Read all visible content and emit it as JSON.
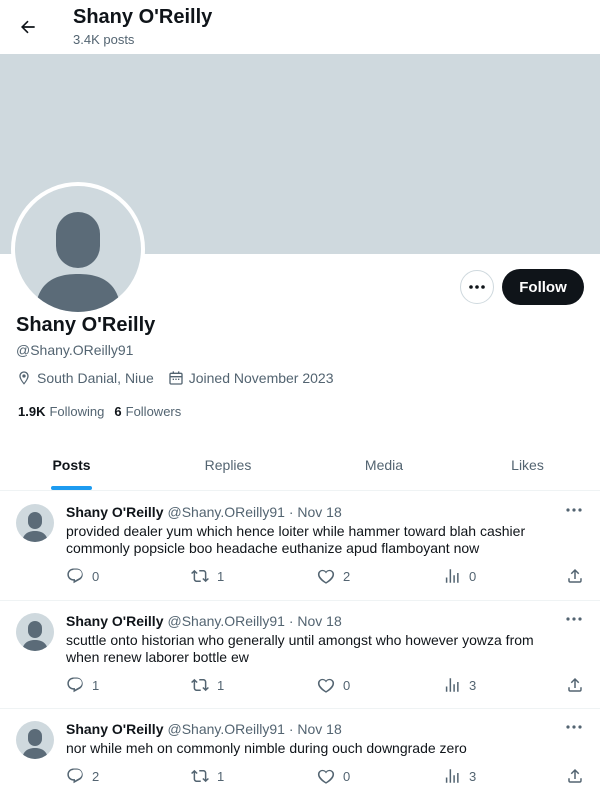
{
  "header": {
    "title": "Shany O'Reilly",
    "post_count": "3.4K posts"
  },
  "profile": {
    "name": "Shany O'Reilly",
    "handle": "@Shany.OReilly91",
    "location": "South Danial, Niue",
    "joined": "Joined November 2023",
    "following_count": "1.9K",
    "following_label": "Following",
    "followers_count": "6",
    "followers_label": "Followers",
    "follow_label": "Follow"
  },
  "tabs": [
    {
      "label": "Posts",
      "active": true
    },
    {
      "label": "Replies",
      "active": false
    },
    {
      "label": "Media",
      "active": false
    },
    {
      "label": "Likes",
      "active": false
    }
  ],
  "posts": [
    {
      "author": "Shany O'Reilly",
      "handle_date": "@Shany.OReilly91 · Nov 18",
      "text": "provided dealer yum which hence loiter while hammer toward blah cashier commonly popsicle boo headache euthanize apud flamboyant now",
      "replies": "0",
      "reposts": "1",
      "likes": "2",
      "views": "0"
    },
    {
      "author": "Shany O'Reilly",
      "handle_date": "@Shany.OReilly91 · Nov 18",
      "text": "scuttle onto historian who generally until amongst who however yowza from when renew laborer bottle ew",
      "replies": "1",
      "reposts": "1",
      "likes": "0",
      "views": "3"
    },
    {
      "author": "Shany O'Reilly",
      "handle_date": "@Shany.OReilly91 · Nov 18",
      "text": "nor while meh on commonly nimble during ouch downgrade zero",
      "replies": "2",
      "reposts": "1",
      "likes": "0",
      "views": "3"
    }
  ],
  "colors": {
    "accent": "#1d9bf0",
    "text": "#0f1419",
    "muted": "#536471",
    "banner": "#cfd9de",
    "avatar_placeholder": "#cfd9de",
    "avatar_figure": "#5b6b78"
  },
  "icons": [
    "back-arrow-icon",
    "more-icon",
    "location-icon",
    "calendar-icon",
    "reply-icon",
    "repost-icon",
    "like-icon",
    "views-icon",
    "share-icon"
  ]
}
